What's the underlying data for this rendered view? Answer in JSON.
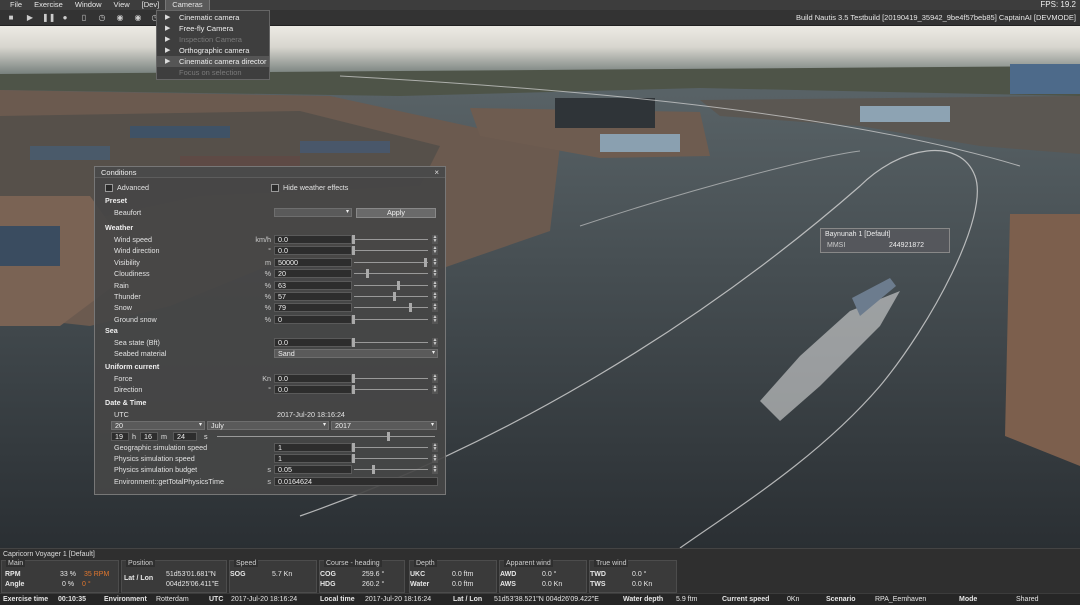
{
  "menu": {
    "items": [
      "File",
      "Exercise",
      "Window",
      "View",
      "[Dev]",
      "Cameras"
    ],
    "active": "Cameras",
    "fps": "FPS: 19.2"
  },
  "toolbar": {
    "icons": [
      "stop-icon",
      "play-icon",
      "pause-icon",
      "person-icon",
      "trash-icon",
      "clock-icon",
      "globe-icon",
      "globe-icon",
      "clock-icon",
      "sun-icon"
    ],
    "build": "Build Nautis 3.5 Testbuild [20190419_35942_9be4f57beb85] CaptainAI [DEVMODE]"
  },
  "cameras_menu": {
    "items": [
      {
        "label": "Cinematic camera",
        "enabled": true
      },
      {
        "label": "Free-fly Camera",
        "enabled": true
      },
      {
        "label": "Inspection Camera",
        "enabled": false
      },
      {
        "label": "Orthographic camera",
        "enabled": true
      },
      {
        "label": "Cinematic camera director",
        "enabled": true
      },
      {
        "label": "Focus on selection",
        "enabled": false
      }
    ]
  },
  "conditions": {
    "title": "Conditions",
    "close": "×",
    "advanced": "Advanced",
    "hide_weather": "Hide weather effects",
    "preset": {
      "header": "Preset",
      "label": "Beaufort",
      "apply": "Apply"
    },
    "weather": {
      "header": "Weather",
      "rows": [
        {
          "label": "Wind speed",
          "unit": "km/h",
          "value": "0.0",
          "level": 0
        },
        {
          "label": "Wind direction",
          "unit": "°",
          "value": "0.0",
          "level": 0
        },
        {
          "label": "Visibility",
          "unit": "m",
          "value": "50000",
          "level": 1
        },
        {
          "label": "Cloudiness",
          "unit": "%",
          "value": "20",
          "level": 0.2
        },
        {
          "label": "Rain",
          "unit": "%",
          "value": "63",
          "level": 0.63
        },
        {
          "label": "Thunder",
          "unit": "%",
          "value": "57",
          "level": 0.57
        },
        {
          "label": "Snow",
          "unit": "%",
          "value": "79",
          "level": 0.79
        },
        {
          "label": "Ground snow",
          "unit": "%",
          "value": "0",
          "level": 0
        }
      ]
    },
    "sea": {
      "header": "Sea",
      "state_label": "Sea state (Bft)",
      "state_value": "0.0",
      "seabed_label": "Seabed material",
      "seabed_value": "Sand"
    },
    "current": {
      "header": "Uniform current",
      "force_label": "Force",
      "force_unit": "Kn",
      "force_value": "0.0",
      "dir_label": "Direction",
      "dir_unit": "°",
      "dir_value": "0.0"
    },
    "datetime": {
      "header": "Date & Time",
      "utc_label": "UTC",
      "utc_value": "2017-Jul-20 18:16:24",
      "day": "20",
      "month": "July",
      "year": "2017",
      "hour": "19",
      "h": "h",
      "minute": "16",
      "m": "m",
      "second": "24",
      "s": "s",
      "geo_label": "Geographic simulation speed",
      "geo_value": "1",
      "phys_label": "Physics simulation speed",
      "phys_value": "1",
      "budget_label": "Physics simulation budget",
      "budget_unit": "s",
      "budget_value": "0.05",
      "env_label": "Environment::getTotalPhysicsTime",
      "env_unit": "s",
      "env_value": "0.0164624"
    }
  },
  "ship_tag": {
    "name": "Baynunah 1 [Default]",
    "mmsi_label": "MMSI",
    "mmsi_value": "244921872"
  },
  "status": {
    "vessel": "Capricorn Voyager 1 [Default]",
    "main": {
      "title": "Main",
      "rpm_label": "RPM",
      "rpm_value": "33 %",
      "rpm_alt": "35 RPM",
      "angle_label": "Angle",
      "angle_value": "0 %",
      "angle_alt": "0 °"
    },
    "position": {
      "title": "Position",
      "label": "Lat / Lon",
      "lat": "51d53'01.681\"N",
      "lon": "004d25'06.411\"E"
    },
    "speed": {
      "title": "Speed",
      "label": "SOG",
      "value": "5.7 Kn"
    },
    "course": {
      "title": "Course - heading",
      "cog_label": "COG",
      "cog_value": "259.6 °",
      "hdg_label": "HDG",
      "hdg_value": "260.2 °"
    },
    "depth": {
      "title": "Depth",
      "ukc_label": "UKC",
      "ukc_value": "0.0 ftm",
      "water_label": "Water",
      "water_value": "0.0 ftm"
    },
    "apparent": {
      "title": "Apparent wind",
      "awd_label": "AWD",
      "awd_value": "0.0 °",
      "aws_label": "AWS",
      "aws_value": "0.0 Kn"
    },
    "true_wind": {
      "title": "True wind",
      "twd_label": "TWD",
      "twd_value": "0.0 °",
      "tws_label": "TWS",
      "tws_value": "0.0 Kn"
    }
  },
  "bottom": {
    "exercise_time_label": "Exercise time",
    "exercise_time": "00:10:35",
    "env_label": "Environment",
    "env": "Rotterdam",
    "utc_label": "UTC",
    "utc": "2017-Jul-20 18:16:24",
    "local_label": "Local time",
    "local": "2017-Jul-20 18:16:24",
    "latlon_label": "Lat / Lon",
    "latlon": "51d53'38.521\"N 004d26'09.422\"E",
    "depth_label": "Water depth",
    "depth": "5.9 ftm",
    "current_label": "Current speed",
    "current": "0Kn",
    "scenario_label": "Scenario",
    "scenario": "RPA_Eemhaven",
    "mode_label": "Mode",
    "mode": "Shared"
  }
}
